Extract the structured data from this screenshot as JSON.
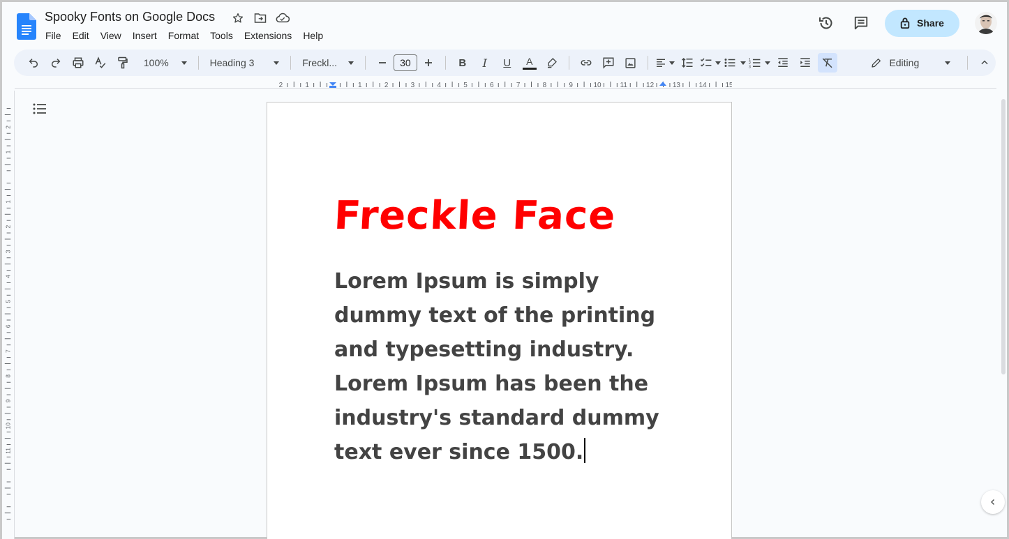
{
  "doc": {
    "title": "Spooky Fonts on Google Docs"
  },
  "menu": [
    "File",
    "Edit",
    "View",
    "Insert",
    "Format",
    "Tools",
    "Extensions",
    "Help"
  ],
  "share": {
    "label": "Share"
  },
  "toolbar": {
    "zoom": "100%",
    "style": "Heading 3",
    "font": "Freckl...",
    "font_size": "30",
    "bold": "B",
    "italic": "I",
    "underline": "U",
    "text_color_glyph": "A",
    "mode": "Editing"
  },
  "ruler": {
    "labels": [
      "2",
      "1",
      "1",
      "2",
      "3",
      "4",
      "5",
      "6",
      "7",
      "8",
      "9",
      "10",
      "11",
      "12",
      "13",
      "14",
      "15"
    ]
  },
  "vruler": {
    "labels": [
      "2",
      "1",
      "1",
      "2",
      "3",
      "4",
      "5",
      "6",
      "7",
      "8",
      "9",
      "10",
      "11"
    ]
  },
  "content": {
    "heading": "Freckle Face",
    "body": "Lorem Ipsum is simply dummy text of the printing and typesetting industry. Lorem Ipsum has been the industry's standard dummy text ever since 1500."
  },
  "colors": {
    "heading": "#ff0000",
    "body": "#434343",
    "share_bg": "#c2e7ff",
    "toolbar_bg": "#edf2fa"
  },
  "icons": [
    "docs-logo-icon",
    "star-icon",
    "move-folder-icon",
    "cloud-saved-icon",
    "history-icon",
    "comment-icon",
    "lock-icon",
    "undo-icon",
    "redo-icon",
    "print-icon",
    "spellcheck-icon",
    "paint-format-icon",
    "text-color-icon",
    "highlight-icon",
    "link-icon",
    "add-comment-icon",
    "image-icon",
    "align-left-icon",
    "line-spacing-icon",
    "checklist-icon",
    "bulleted-list-icon",
    "numbered-list-icon",
    "decrease-indent-icon",
    "increase-indent-icon",
    "clear-formatting-icon",
    "pencil-icon",
    "chevron-up-icon",
    "outline-icon",
    "chevron-left-icon"
  ]
}
